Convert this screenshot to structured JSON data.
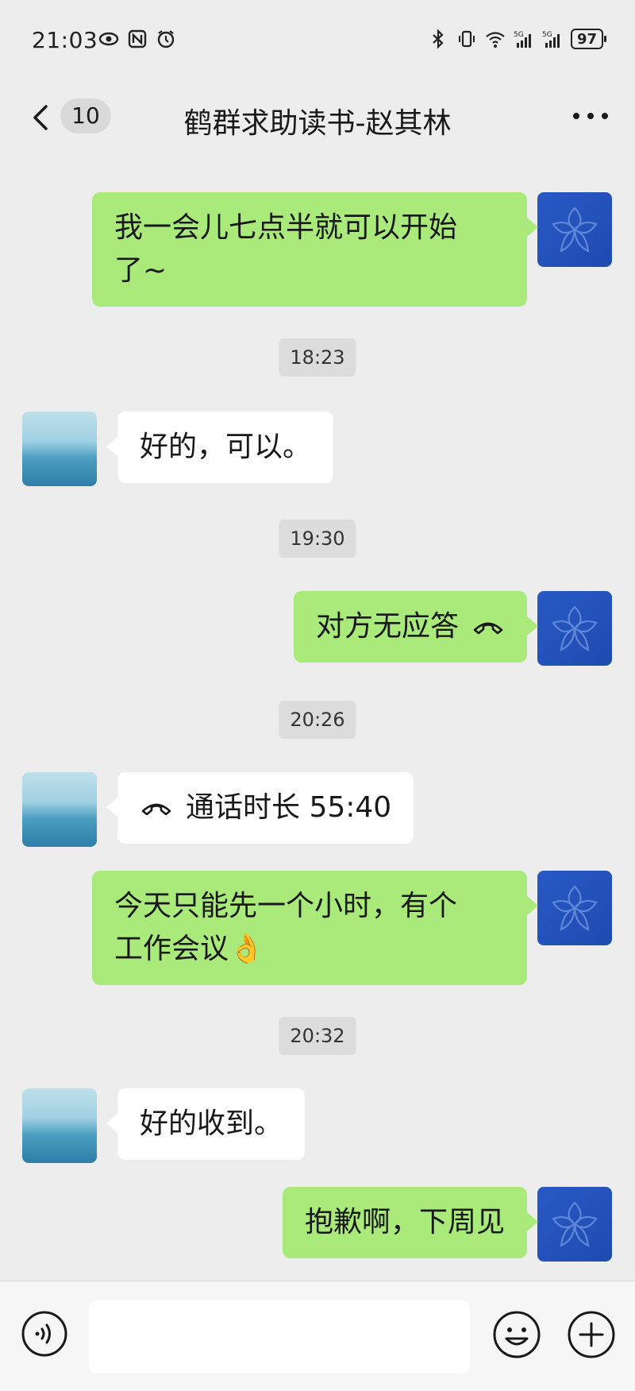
{
  "status_bar": {
    "time": "21:03",
    "battery": "97",
    "network_1": "5G",
    "network_2": "5G"
  },
  "header": {
    "unread_count": "10",
    "title": "鹤群求助读书-赵其林"
  },
  "messages": [
    {
      "from": "self",
      "text_line1": "我一会儿七点半就可以开始",
      "text_line2": "了~"
    },
    {
      "timestamp": "18:23"
    },
    {
      "from": "other",
      "text": "好的，可以。"
    },
    {
      "timestamp": "19:30"
    },
    {
      "from": "self",
      "type": "call",
      "text": "对方无应答"
    },
    {
      "timestamp": "20:26"
    },
    {
      "from": "other",
      "type": "call",
      "text": "通话时长 55:40"
    },
    {
      "from": "self",
      "text_line1": "今天只能先一个小时，有个",
      "text_line2": "工作会议👌"
    },
    {
      "timestamp": "20:32"
    },
    {
      "from": "other",
      "text": "好的收到。"
    },
    {
      "from": "self",
      "text": "抱歉啊，下周见"
    }
  ],
  "input": {
    "placeholder": ""
  },
  "icons": {
    "back": "chevron-left-icon",
    "more": "more-dots-icon",
    "voice": "voice-icon",
    "emoji": "emoji-icon",
    "plus": "plus-icon",
    "call": "phone-hangup-icon"
  },
  "colors": {
    "background": "#ededed",
    "self_bubble": "#a9ea7a",
    "other_bubble": "#ffffff",
    "self_avatar": "#2759c4"
  }
}
